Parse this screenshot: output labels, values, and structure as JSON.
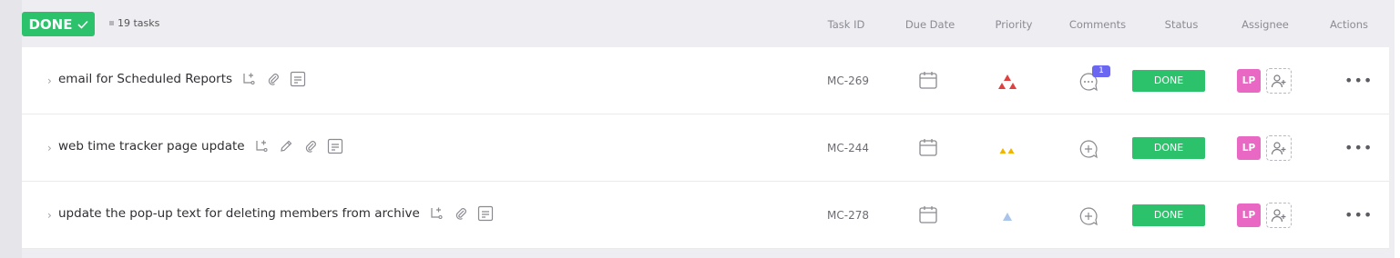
{
  "group": {
    "status_label": "DONE",
    "status_color": "#2bc26b",
    "task_count": "19 tasks"
  },
  "columns": {
    "task_id": "Task ID",
    "due_date": "Due Date",
    "priority": "Priority",
    "comments": "Comments",
    "status": "Status",
    "assignee": "Assignee",
    "actions": "Actions"
  },
  "tasks": [
    {
      "title": "email for Scheduled Reports",
      "task_id": "MC-269",
      "priority": "urgent",
      "priority_color": "#e0413f",
      "comment_count": "1",
      "status": "DONE",
      "assignee_initials": "LP",
      "icons": [
        "subtask-icon",
        "attachment-icon",
        "description-icon"
      ]
    },
    {
      "title": "web time tracker page update",
      "task_id": "MC-244",
      "priority": "high",
      "priority_color": "#f0b400",
      "status": "DONE",
      "assignee_initials": "LP",
      "icons": [
        "subtask-icon",
        "edit-icon",
        "attachment-icon",
        "description-icon"
      ]
    },
    {
      "title": "update the pop-up text for deleting members from archive",
      "task_id": "MC-278",
      "priority": "low",
      "priority_color": "#a9c6ea",
      "status": "DONE",
      "assignee_initials": "LP",
      "icons": [
        "subtask-icon",
        "attachment-icon",
        "description-icon"
      ]
    }
  ]
}
